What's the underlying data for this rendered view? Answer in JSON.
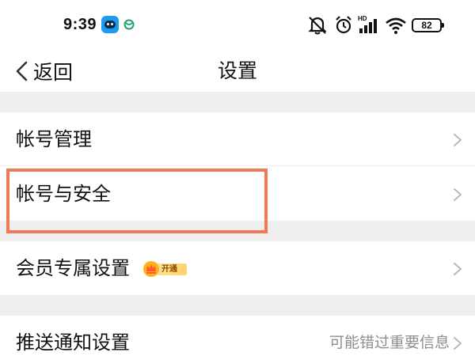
{
  "status_bar": {
    "time": "9:39",
    "battery": "82",
    "icons": [
      "app-icon",
      "carrier-icon",
      "mute-icon",
      "alarm-icon",
      "signal-icon",
      "wifi-icon",
      "battery-icon"
    ],
    "signal_tag": "HD"
  },
  "nav": {
    "back_label": "返回",
    "title": "设置"
  },
  "settings": {
    "account_management": "帐号管理",
    "account_security": "帐号与安全",
    "vip_settings": "会员专属设置",
    "vip_badge": "开通",
    "push_settings": "推送通知设置",
    "push_hint": "可能错过重要信息"
  },
  "colors": {
    "highlight": "#f07a57",
    "section_gap": "#efefef",
    "hint": "#8e8e8e",
    "chevron": "#b8b8b8"
  }
}
